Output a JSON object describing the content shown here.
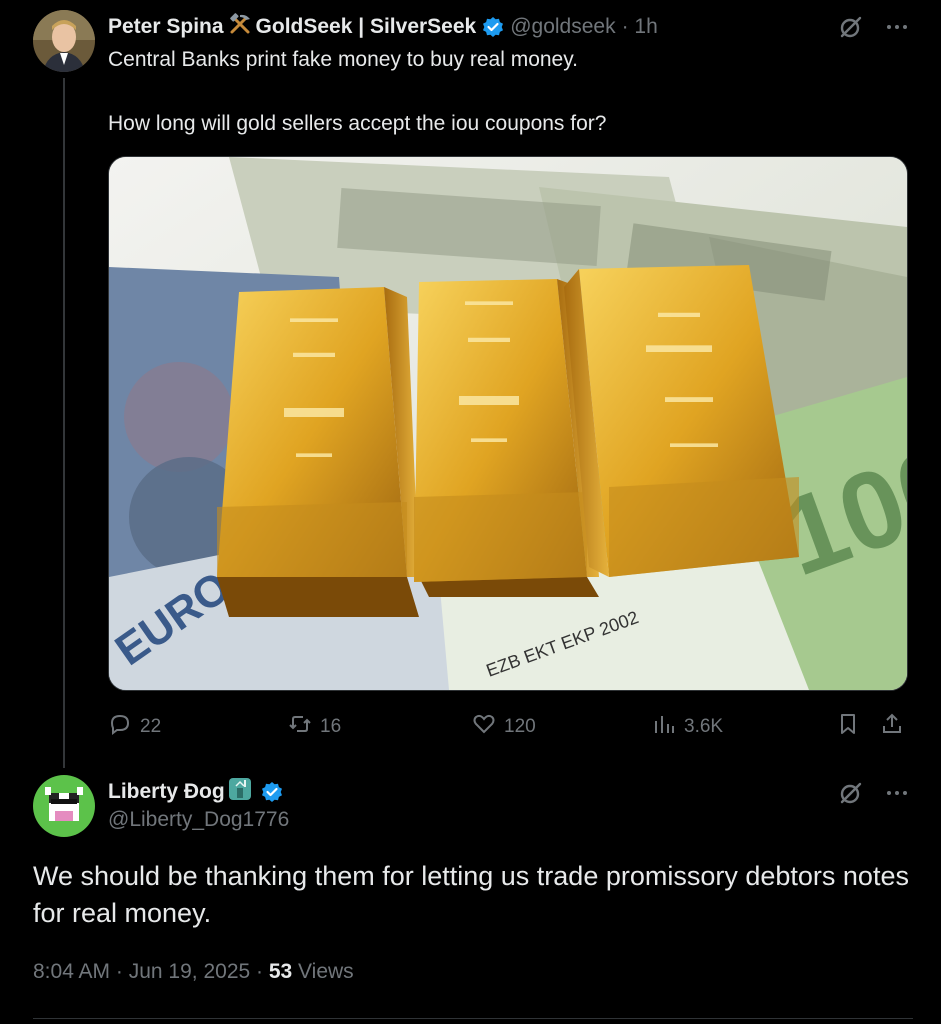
{
  "tweet1": {
    "author_name": "Peter Spina",
    "author_org": "GoldSeek | SilverSeek",
    "handle": "@goldseek",
    "time": "· 1h",
    "line1": "Central Banks print fake money to buy real money.",
    "line2": "How long will gold sellers accept the iou coupons for?",
    "media_alt": "Gold bars on banknotes",
    "actions": {
      "replies": "22",
      "reposts": "16",
      "likes": "120",
      "views": "3.6K"
    }
  },
  "tweet2": {
    "author_name": "Liberty Đog",
    "handle": "@Liberty_Dog1776",
    "text": "We should be thanking them for letting us trade promissory debtors notes for real money.",
    "time": "8:04 AM",
    "date": "Jun 19, 2025",
    "views_count": "53",
    "views_label": "Views"
  },
  "colors": {
    "verified": "#1d9bf0",
    "muted": "#71767b",
    "text": "#e7e9ea"
  }
}
